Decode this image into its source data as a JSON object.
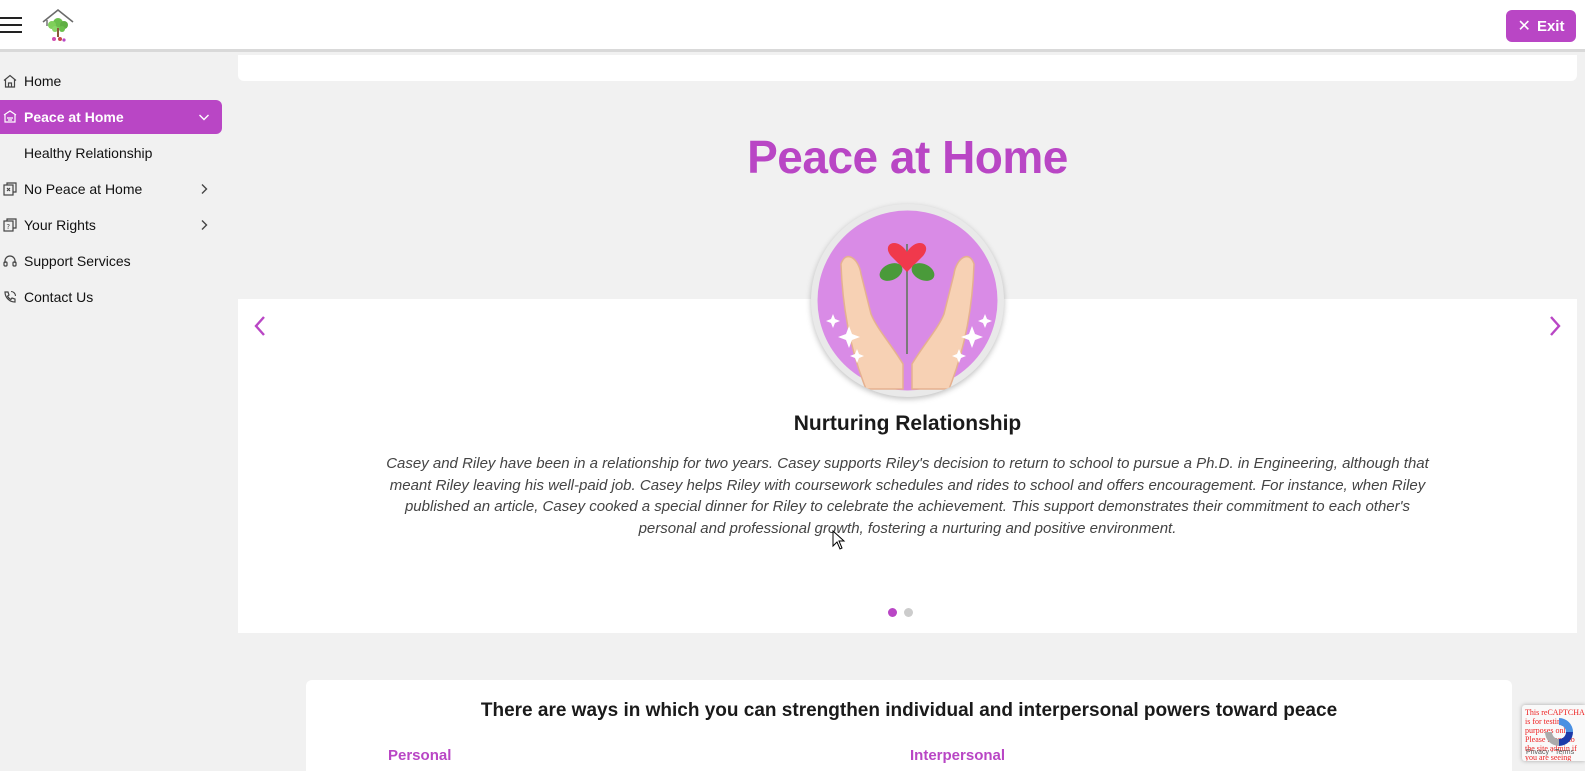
{
  "header": {
    "exit_label": "Exit",
    "brand_color": "#b946c5"
  },
  "sidebar": {
    "items": [
      {
        "label": "Home",
        "icon": "home-icon"
      },
      {
        "label": "Peace at Home",
        "icon": "peace-home-icon",
        "active": true,
        "expanded": true
      },
      {
        "label": "Healthy Relationship",
        "sub": true
      },
      {
        "label": "No Peace at Home",
        "icon": "no-peace-icon",
        "has_children": true
      },
      {
        "label": "Your Rights",
        "icon": "rights-icon",
        "has_children": true
      },
      {
        "label": "Support Services",
        "icon": "support-icon"
      },
      {
        "label": "Contact Us",
        "icon": "phone-icon"
      }
    ]
  },
  "main": {
    "title": "Peace at Home",
    "carousel": {
      "slide_title": "Nurturing Relationship",
      "slide_text": "Casey and Riley have been in a relationship for two years. Casey supports Riley's decision to return to school to pursue a Ph.D. in Engineering, although that meant Riley leaving his well-paid job. Casey helps Riley with coursework schedules and rides to school and offers encouragement. For instance, when Riley published an article, Casey cooked a special dinner for Riley to celebrate the achievement. This support demonstrates their commitment to each other's personal and professional growth, fostering a nurturing and positive environment.",
      "current_slide": 1,
      "total_slides": 2
    },
    "ways": {
      "title": "There are ways in which you can strengthen individual and interpersonal powers toward peace",
      "col_personal": "Personal",
      "col_interpersonal": "Interpersonal"
    }
  },
  "recaptcha": {
    "error_text": "This reCAPTCHA is for testing purposes only. Please report to the site admin if you are seeing this.",
    "terms": "Privacy - Terms"
  }
}
